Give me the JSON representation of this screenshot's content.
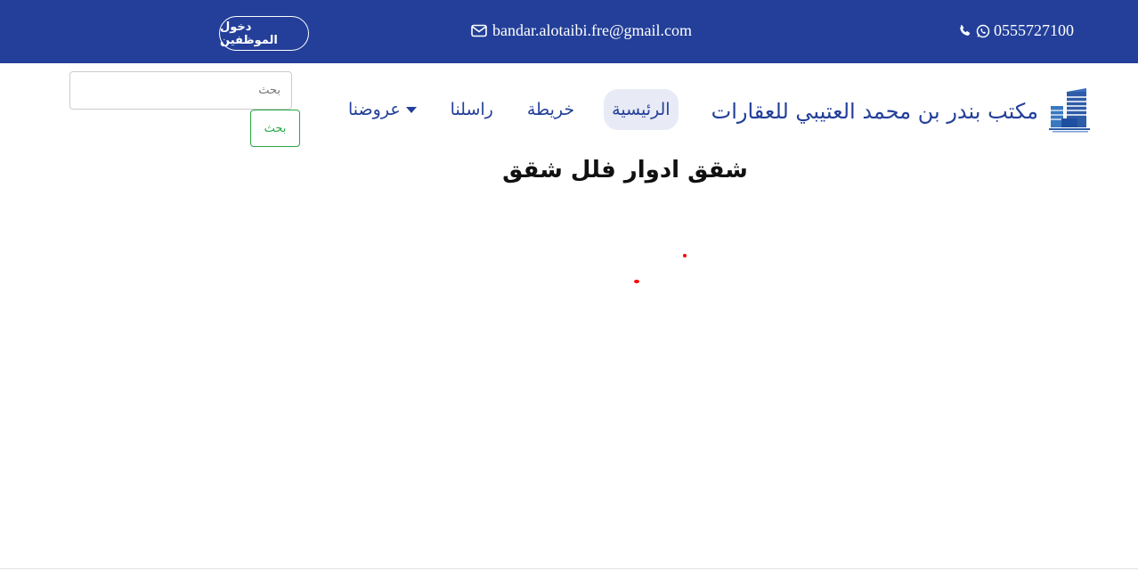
{
  "topbar": {
    "phone": "0555727100",
    "email": "bandar.alotaibi.fre@gmail.com",
    "staff_login": "دخول الموظفين"
  },
  "brand": {
    "name": "مكتب بندر بن محمد العتيبي للعقارات"
  },
  "nav": {
    "items": [
      {
        "label": "الرئيسية",
        "active": true
      },
      {
        "label": "خريطة"
      },
      {
        "label": "راسلنا"
      },
      {
        "label": "عروضنا"
      }
    ]
  },
  "search": {
    "placeholder": "بحث",
    "button_label": "بحث"
  },
  "main": {
    "title": "شقق ادوار فلل شقق"
  },
  "colors": {
    "brand_blue": "#233f99",
    "search_green": "#28a745",
    "marker_red": "#ff0000"
  },
  "icons": {
    "phone": "phone-icon",
    "whatsapp": "whatsapp-icon",
    "email": "envelope-icon"
  }
}
